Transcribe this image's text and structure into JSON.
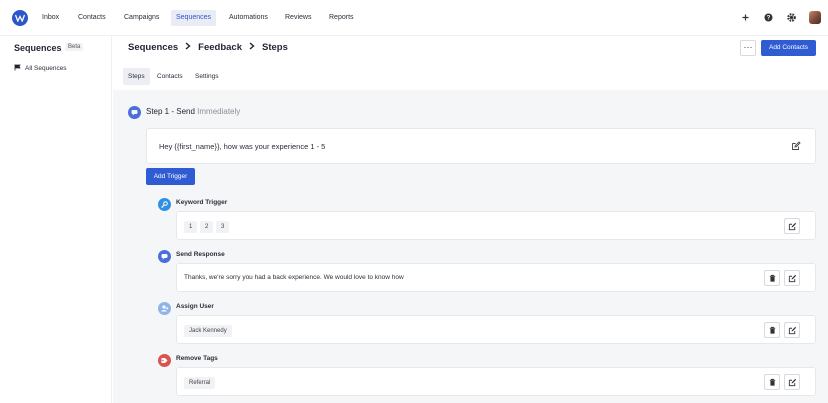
{
  "nav": {
    "items": [
      {
        "label": "Inbox"
      },
      {
        "label": "Contacts"
      },
      {
        "label": "Campaigns"
      },
      {
        "label": "Sequences"
      },
      {
        "label": "Automations"
      },
      {
        "label": "Reviews"
      },
      {
        "label": "Reports"
      }
    ],
    "active": "Sequences",
    "icons": [
      "plus-icon",
      "help-icon",
      "gear-icon"
    ],
    "accent_color": "#2b57c9"
  },
  "sidebar": {
    "title": "Sequences",
    "badge": "Beta",
    "items": [
      {
        "label": "All Sequences",
        "icon": "flag-icon"
      }
    ]
  },
  "header": {
    "breadcrumb": [
      "Sequences",
      "Feedback",
      "Steps"
    ],
    "more_label": "···",
    "primary_button": "Add Contacts",
    "tabs": [
      {
        "label": "Steps"
      },
      {
        "label": "Contacts"
      },
      {
        "label": "Settings"
      }
    ],
    "active_tab": "Steps"
  },
  "step": {
    "title": "Step 1 - Send",
    "timing": "Immediately",
    "message": "Hey {{first_name}}, how was your experience 1 - 5",
    "add_trigger_label": "Add Trigger"
  },
  "triggers": [
    {
      "label": "Keyword Trigger",
      "icon": "key-icon",
      "icon_color": "#2f8fe0",
      "chips": [
        "1",
        "2",
        "3"
      ]
    },
    {
      "label": "Send Response",
      "icon": "chat-icon",
      "icon_color": "#4a6fd8",
      "text": "Thanks, we're sorry you had a back experience. We would love to know how"
    },
    {
      "label": "Assign User",
      "icon": "user-icon",
      "icon_color": "#8fb5e8",
      "chip": "Jack Kennedy"
    },
    {
      "label": "Remove Tags",
      "icon": "tag-icon",
      "icon_color": "#d9534f",
      "chip": "Referral"
    }
  ]
}
